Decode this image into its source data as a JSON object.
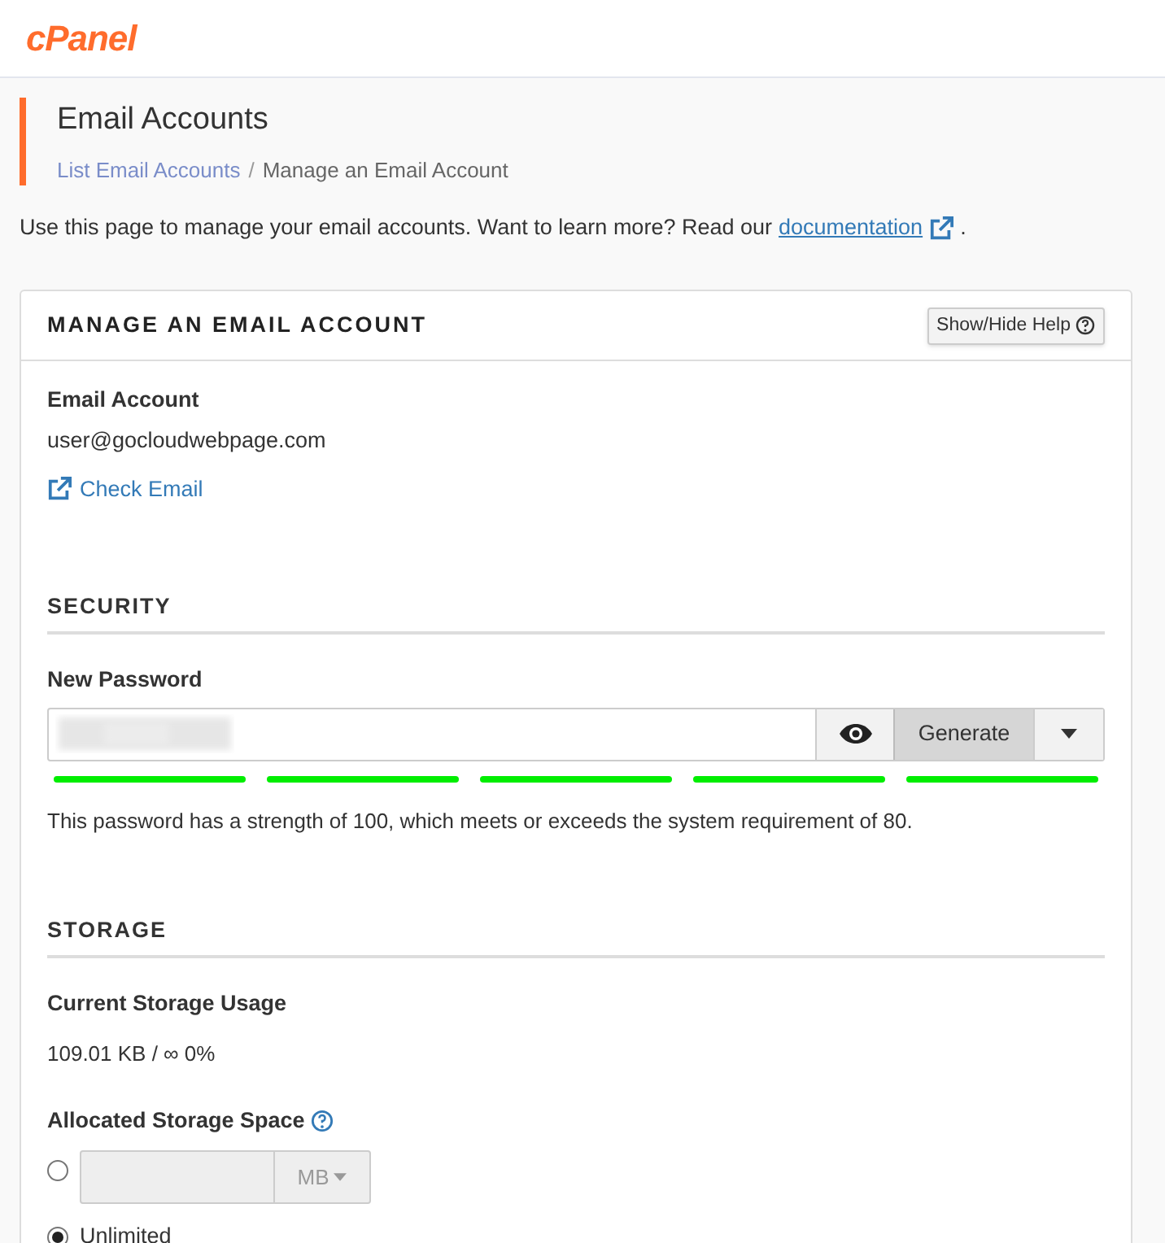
{
  "logo": "cPanel",
  "page": {
    "title": "Email Accounts",
    "separator": "/",
    "breadcrumbs": [
      {
        "label": "List Email Accounts",
        "kind": "link"
      },
      {
        "label": "Manage an Email Account",
        "kind": "current"
      }
    ]
  },
  "intro": {
    "text": "Use this page to manage your email accounts. Want to learn more? Read our",
    "link": "documentation",
    "after": "."
  },
  "panel": {
    "title": "MANAGE AN EMAIL ACCOUNT",
    "help_button": "Show/Hide Help",
    "account": {
      "label": "Email Account",
      "value": "user@gocloudwebpage.com",
      "link": "Check Email"
    },
    "security": {
      "heading": "SECURITY",
      "label": "New Password",
      "generate": "Generate",
      "strength_segments": [
        {
          "filled": true
        },
        {
          "filled": true
        },
        {
          "filled": true
        },
        {
          "filled": true
        },
        {
          "filled": true
        }
      ],
      "message": "This password has a strength of 100, which meets or exceeds the system requirement of 80."
    },
    "storage": {
      "heading": "STORAGE",
      "usage_label": "Current Storage Usage",
      "usage_value": "109.01 KB / ∞ 0%",
      "allocated_label": "Allocated Storage Space",
      "options": [
        {
          "kind": "quota",
          "selected": false,
          "unit": "MB"
        },
        {
          "kind": "unlimited",
          "selected": true,
          "label": "Unlimited"
        }
      ]
    }
  }
}
